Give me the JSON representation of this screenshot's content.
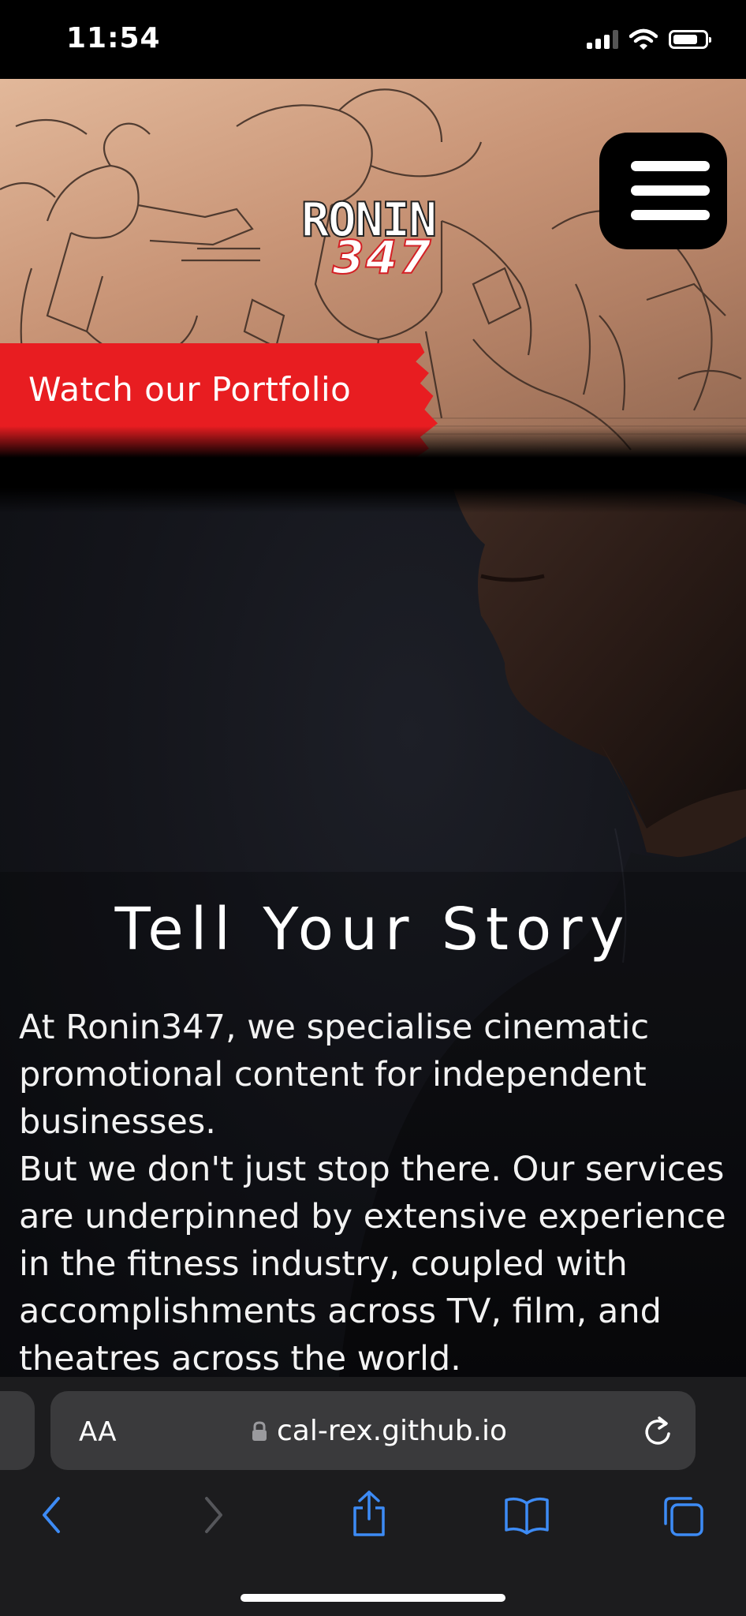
{
  "status_bar": {
    "time": "11:54"
  },
  "hero": {
    "logo_top": "RONIN",
    "logo_bottom": "347",
    "portfolio_label": "Watch our Portfolio"
  },
  "story": {
    "title": "Tell Your Story",
    "paragraph_1": "At Ronin347, we specialise cinematic promotional content for independent businesses.",
    "paragraph_2": "But we don't just stop there. Our services are underpinned by extensive experience in the fitness industry, coupled with accomplishments across TV, film, and theatres across the world."
  },
  "browser": {
    "text_size_label": "AA",
    "url": "cal-rex.github.io"
  },
  "colors": {
    "accent_red": "#e81d21",
    "safari_blue": "#3d8bf5",
    "toolbar_bg": "#1c1c1e"
  },
  "icons": [
    "wifi-icon",
    "battery-icon",
    "menu-icon",
    "lock-icon",
    "reload-icon",
    "back-icon",
    "forward-icon",
    "share-icon",
    "bookmarks-icon",
    "tabs-icon"
  ]
}
